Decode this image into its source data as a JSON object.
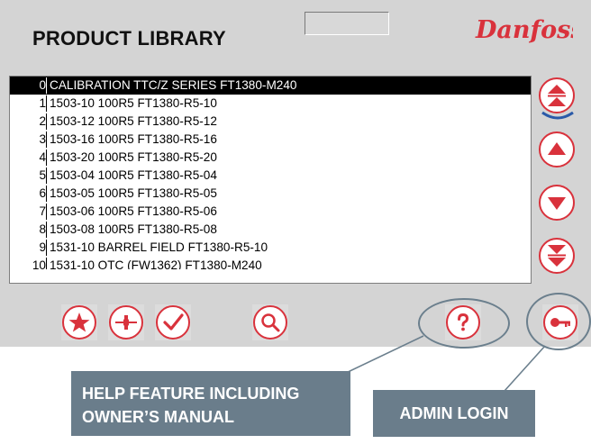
{
  "header": {
    "title": "PRODUCT LIBRARY",
    "brand": "Danfoss",
    "top_field_value": ""
  },
  "colors": {
    "accent_red": "#d9323c",
    "callout_slate": "#6a7d8b",
    "panel_gray": "#d4d4d4",
    "selection_black": "#000000"
  },
  "product_list": {
    "selected_index": 0,
    "items": [
      {
        "index": "0",
        "name": "CALIBRATION TTC/Z SERIES FT1380-M240"
      },
      {
        "index": "1",
        "name": "1503-10 100R5 FT1380-R5-10"
      },
      {
        "index": "2",
        "name": "1503-12 100R5 FT1380-R5-12"
      },
      {
        "index": "3",
        "name": "1503-16 100R5 FT1380-R5-16"
      },
      {
        "index": "4",
        "name": "1503-20 100R5 FT1380-R5-20"
      },
      {
        "index": "5",
        "name": "1503-04 100R5 FT1380-R5-04"
      },
      {
        "index": "6",
        "name": "1503-05 100R5 FT1380-R5-05"
      },
      {
        "index": "7",
        "name": "1503-06 100R5 FT1380-R5-06"
      },
      {
        "index": "8",
        "name": "1503-08 100R5 FT1380-R5-08"
      },
      {
        "index": "9",
        "name": "1531-10 BARREL FIELD FT1380-R5-10"
      },
      {
        "index": "10",
        "name": "1531-10 OTC (FW1362) FT1380-M240"
      }
    ]
  },
  "nav_buttons": [
    {
      "name": "page-up",
      "icon": "double-chevron-up-icon"
    },
    {
      "name": "line-up",
      "icon": "triangle-up-icon"
    },
    {
      "name": "line-down",
      "icon": "triangle-down-icon"
    },
    {
      "name": "page-down",
      "icon": "double-chevron-down-icon"
    }
  ],
  "toolbar": [
    {
      "name": "favorite",
      "icon": "star-icon"
    },
    {
      "name": "compare",
      "icon": "compress-arrows-icon"
    },
    {
      "name": "select",
      "icon": "checkmark-icon"
    },
    {
      "name": "search",
      "icon": "magnifier-icon"
    },
    {
      "name": "help",
      "icon": "question-icon"
    },
    {
      "name": "admin-login",
      "icon": "key-icon"
    }
  ],
  "callouts": {
    "help_line1": "HELP FEATURE INCLUDING",
    "help_line2": "OWNER’S MANUAL",
    "admin": "ADMIN LOGIN"
  }
}
